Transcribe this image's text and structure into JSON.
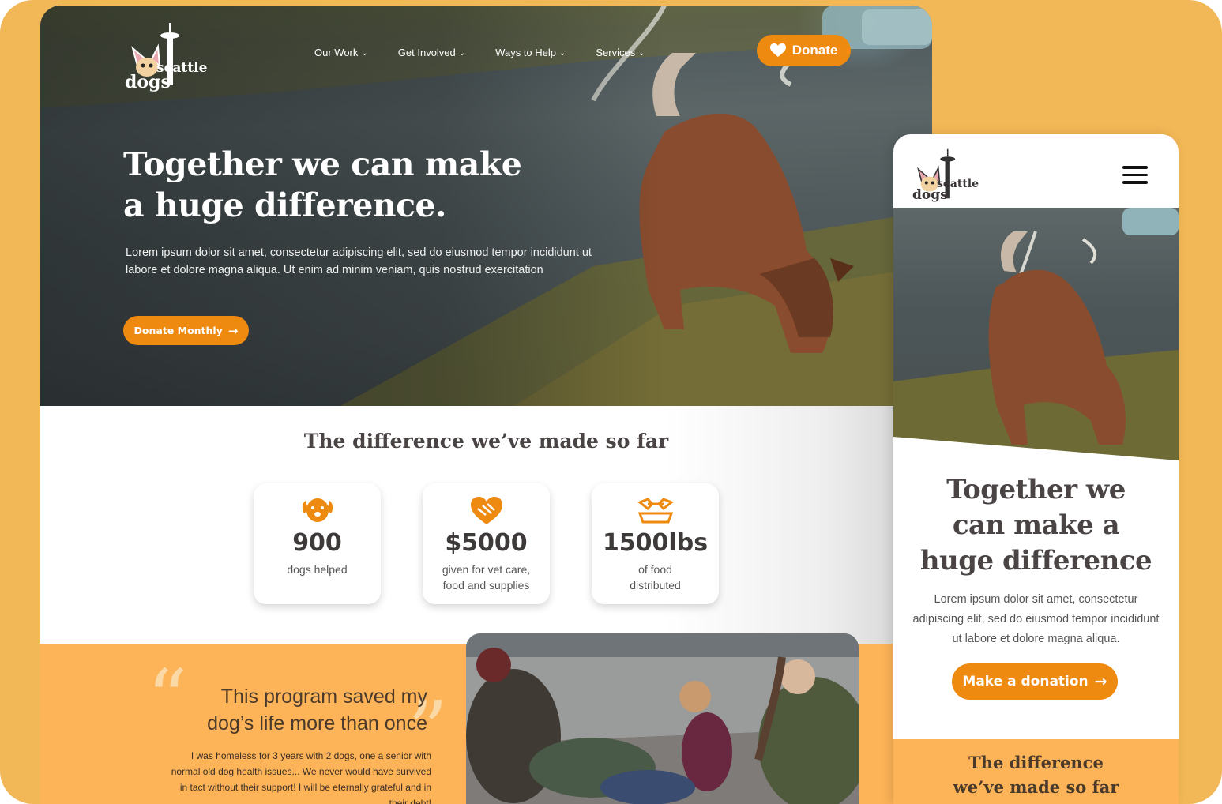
{
  "brand": {
    "line1": "seattle",
    "line2": "dogs"
  },
  "nav": {
    "items": [
      {
        "label": "Our Work"
      },
      {
        "label": "Get Involved"
      },
      {
        "label": "Ways to Help"
      },
      {
        "label": "Services"
      }
    ],
    "donate_label": "Donate"
  },
  "hero": {
    "title_line1": "Together we can make",
    "title_line2": "a huge difference.",
    "body": "Lorem ipsum dolor sit amet, consectetur adipiscing elit, sed do eiusmod tempor incididunt ut labore et dolore magna aliqua. Ut enim ad minim veniam, quis nostrud exercitation",
    "cta_label": "Donate Monthly"
  },
  "stats": {
    "title": "The difference we’ve made so far",
    "cards": [
      {
        "icon": "dog-face-icon",
        "value": "900",
        "desc_line1": "dogs helped",
        "desc_line2": ""
      },
      {
        "icon": "heart-handshake-icon",
        "value": "$5000",
        "desc_line1": "given for vet care,",
        "desc_line2": "food and supplies"
      },
      {
        "icon": "dog-bowl-icon",
        "value": "1500lbs",
        "desc_line1": "of food",
        "desc_line2": "distributed"
      }
    ]
  },
  "testimonial": {
    "quote_line1": "This program saved my",
    "quote_line2": "dog’s life more than once",
    "body": "I was homeless for 3 years with 2 dogs, one a senior with normal old dog health issues... We never would have survived in tact without their support! I will be eternally grateful and in their debt!"
  },
  "mobile": {
    "title": "Together we can make a huge difference",
    "body": "Lorem ipsum dolor sit amet, consectetur adipiscing elit, sed do eiusmod tempor incididunt ut labore et dolore magna aliqua.",
    "cta_label": "Make a donation",
    "stats_title_line1": "The difference",
    "stats_title_line2": "we’ve made so far"
  },
  "colors": {
    "accent": "#ef8a10",
    "background": "#f2b756",
    "section_orange": "#fdb357",
    "heading_dark": "#4a4444"
  }
}
